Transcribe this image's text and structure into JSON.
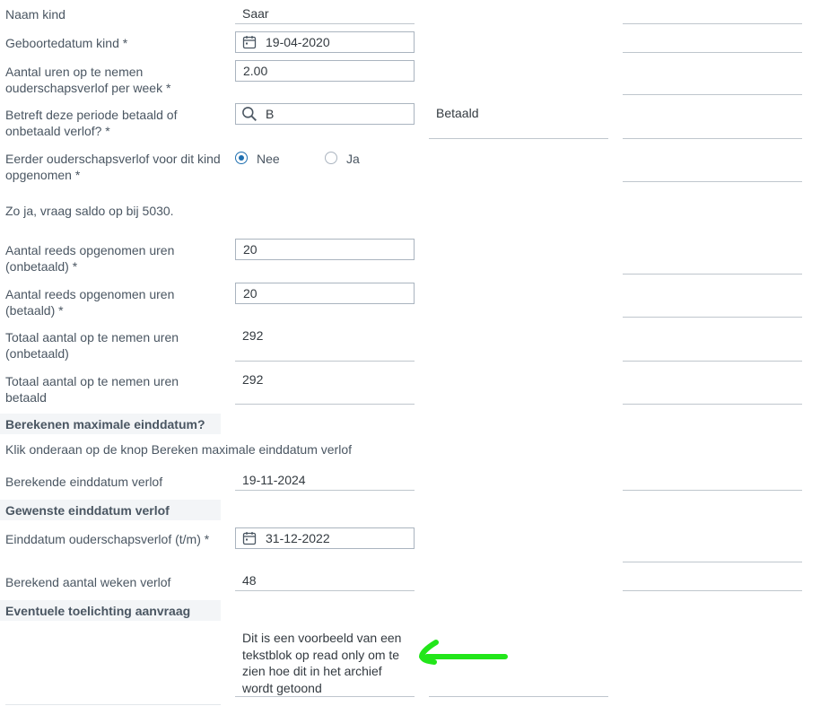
{
  "fields": [
    {
      "label": "Naam kind",
      "value": "Saar"
    },
    {
      "label": "Geboortedatum kind *",
      "value": "19-04-2020",
      "icon": "calendar-icon"
    },
    {
      "label": "Aantal uren op te nemen ouderschapsverlof per week *",
      "value": "2.00"
    },
    {
      "label": "Betreft deze periode betaald of onbetaald verlof? *",
      "value": "B",
      "icon": "search-icon",
      "lookup_result": "Betaald"
    },
    {
      "label": "Eerder ouderschapsverlof voor dit kind opgenomen *",
      "options": [
        "Nee",
        "Ja"
      ],
      "selected": "Nee"
    },
    {
      "label": "Aantal reeds opgenomen uren (onbetaald) *",
      "value": "20"
    },
    {
      "label": "Aantal reeds opgenomen uren (betaald) *",
      "value": "20"
    },
    {
      "label": "Totaal aantal op te nemen uren (onbetaald)",
      "value": "292"
    },
    {
      "label": "Totaal aantal op te nemen uren betaald",
      "value": "292"
    },
    {
      "label": "Berekende einddatum verlof",
      "value": "19-11-2024"
    },
    {
      "label": "Einddatum ouderschapsverlof (t/m) *",
      "value": "31-12-2022",
      "icon": "calendar-icon"
    },
    {
      "label": "Berekend aantal weken verlof",
      "value": "48"
    }
  ],
  "notes": {
    "saldo": "Zo ja, vraag saldo op bij 5030.",
    "calc_hint": "Klik onderaan op de knop Bereken  maximale einddatum verlof"
  },
  "sections": {
    "max_enddate": "Berekenen maximale einddatum?",
    "desired_enddate": "Gewenste einddatum verlof",
    "explanation": "Eventuele toelichting aanvraag"
  },
  "explanation_text": "Dit is een voorbeeld van een tekstblok op read only om te zien hoe dit in het archief wordt getoond",
  "colors": {
    "annotation_arrow": "#22e61a",
    "radio_selected": "#1f6fb0",
    "section_background": "#f3f5f7"
  }
}
